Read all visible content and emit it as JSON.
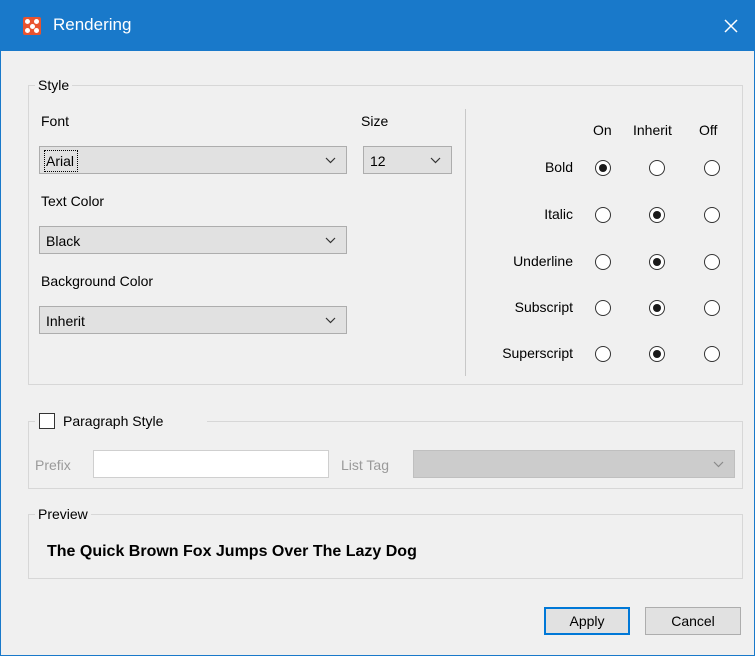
{
  "window": {
    "title": "Rendering",
    "icon": "app-grid-icon",
    "accent": "#1979ca",
    "icon_color": "#e9532f"
  },
  "style_group": {
    "legend": "Style",
    "font": {
      "label": "Font",
      "value": "Arial"
    },
    "size": {
      "label": "Size",
      "value": "12"
    },
    "text_color": {
      "label": "Text Color",
      "value": "Black"
    },
    "background_color": {
      "label": "Background Color",
      "value": "Inherit"
    },
    "columns": {
      "on": "On",
      "inherit": "Inherit",
      "off": "Off"
    },
    "rows": [
      {
        "label": "Bold",
        "selected": "on"
      },
      {
        "label": "Italic",
        "selected": "inherit"
      },
      {
        "label": "Underline",
        "selected": "inherit"
      },
      {
        "label": "Subscript",
        "selected": "inherit"
      },
      {
        "label": "Superscript",
        "selected": "inherit"
      }
    ]
  },
  "paragraph_group": {
    "legend": "Paragraph Style",
    "checked": false,
    "prefix_label": "Prefix",
    "prefix_value": "",
    "list_tag_label": "List Tag",
    "list_tag_value": ""
  },
  "preview_group": {
    "legend": "Preview",
    "text": "The Quick Brown Fox Jumps Over The Lazy Dog"
  },
  "buttons": {
    "apply": "Apply",
    "cancel": "Cancel"
  }
}
